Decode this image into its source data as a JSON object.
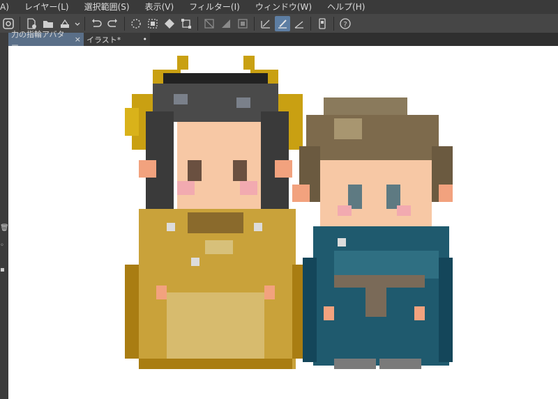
{
  "menu": [
    "A)",
    "レイヤー(L)",
    "選択範囲(S)",
    "表示(V)",
    "フィルター(I)",
    "ウィンドウ(W)",
    "ヘルプ(H)"
  ],
  "toolbar": {
    "icons": [
      "clip-studio-icon",
      "new-file-icon",
      "open-folder-icon",
      "print-icon",
      "undo-icon",
      "redo-icon",
      "marching-ants-icon",
      "clear-icon",
      "fill-icon",
      "transform-icon",
      "snap-off-icon",
      "snap-special-icon",
      "snap-grid-icon",
      "ruler-snap-icon",
      "brush-snap-icon",
      "perspective-snap-icon",
      "device-icon",
      "help-icon"
    ]
  },
  "tabs": [
    {
      "label": "力の指輪アバター",
      "close": "×",
      "active": true
    },
    {
      "label": "イラスト*",
      "close": "•",
      "active": false
    }
  ],
  "colors": {
    "menubar": "#3a3a3a",
    "toolbar": "#464646",
    "tab_active": "#5a6f88",
    "canvas": "#ffffff",
    "gold_dark": "#a97d12",
    "gold": "#c9a23a",
    "gold_light": "#d7bb6e",
    "hair_dark": "#3a3a3a",
    "skin": "#f7c8a5",
    "teal": "#1f5a6e",
    "teal_dark": "#14465a",
    "brown_hair": "#7d6a4c"
  },
  "canvas_art": "pixel-art-two-characters"
}
